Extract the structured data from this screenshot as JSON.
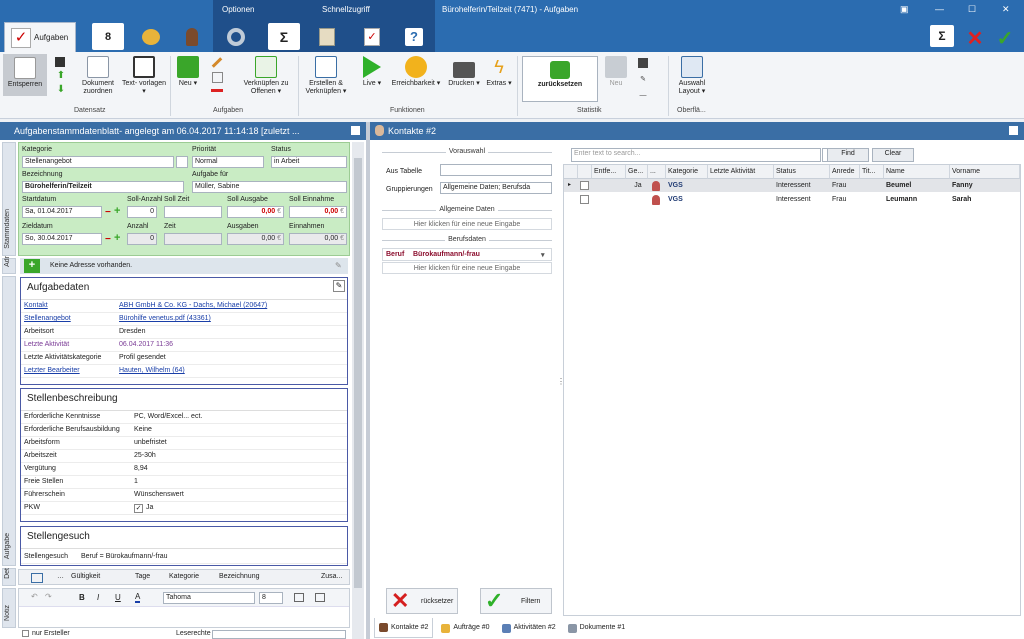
{
  "window": {
    "title": "Bürohelferin/Teilzeit (7471) - Aufgaben",
    "context_tabs": [
      "Optionen",
      "Schnellzugriff"
    ]
  },
  "ribbon": {
    "active_tab": "Aufgaben",
    "buttons": {
      "entsperren": "Entsperren",
      "dokument_zuordnen": "Dokument zuordnen",
      "textvorlagen": "Text- vorlagen ▾",
      "neu": "Neu ▾",
      "verknuepfen": "Verknüpfen zu Offenen ▾",
      "erstellen": "Erstellen & Verknüpfen ▾",
      "live": "Live ▾",
      "erreichbarkeit": "Erreichbarkeit ▾",
      "drucken": "Drucken ▾",
      "extras": "Extras ▾",
      "zuruecksetzen": "zurücksetzen",
      "neu2": "Neu",
      "auswahl_layout": "Auswahl Layout ▾"
    },
    "groups": {
      "datensatz": "Datensatz",
      "aufgaben": "Aufgaben",
      "funktionen": "Funktionen",
      "statistik": "Statistik",
      "oberflaeche": "Oberflä..."
    }
  },
  "left": {
    "header": "Aufgabenstammdatenblatt- angelegt am 06.04.2017 11:14:18 [zuletzt ...",
    "vtabs": [
      "Stammdaten",
      "Adr",
      "Aufgabe",
      "Det",
      "Notiz"
    ],
    "stamm": {
      "kategorie_label": "Kategorie",
      "kategorie": "Stellenangebot",
      "prioritaet_label": "Priorität",
      "prioritaet": "Normal",
      "status_label": "Status",
      "status": "in Arbeit",
      "bezeichnung_label": "Bezeichnung",
      "bezeichnung": "Bürohelferin/Teilzeit",
      "aufgabe_fuer_label": "Aufgabe für",
      "aufgabe_fuer": "Müller, Sabine",
      "startdatum_label": "Startdatum",
      "startdatum": "Sa, 01.04.2017",
      "soll_anzahl_label": "Soll-Anzahl",
      "soll_anzahl": "0",
      "soll_zeit_label": "Soll Zeit",
      "soll_ausgabe_label": "Soll Ausgabe",
      "soll_ausgabe": "0,00",
      "soll_einnahme_label": "Soll Einnahme",
      "soll_einnahme": "0,00",
      "zieldatum_label": "Zieldatum",
      "zieldatum": "So, 30.04.2017",
      "anzahl_label": "Anzahl",
      "anzahl": "0",
      "zeit_label": "Zeit",
      "ausgaben_label": "Ausgaben",
      "ausgaben": "0,00",
      "einnahmen_label": "Einnahmen",
      "einnahmen": "0,00",
      "currency": "€"
    },
    "adresse": "Keine Adresse vorhanden.",
    "aufgabendaten": {
      "title": "Aufgabedaten",
      "rows": [
        {
          "k": "Kontakt",
          "v": "ABH GmbH & Co. KG - Dachs, Michael (20647)"
        },
        {
          "k": "Stellenangebot",
          "v": "Bürohilfe venetus.pdf (43361)"
        },
        {
          "k": "Arbeitsort",
          "v": "Dresden"
        },
        {
          "k": "Letzte Aktivität",
          "v": "06.04.2017 11:36"
        },
        {
          "k": "Letzte Aktivitätskategorie",
          "v": "Profil gesendet"
        },
        {
          "k": "Letzter Bearbeiter",
          "v": "Hauten, Wilhelm (64)"
        }
      ]
    },
    "stellenbeschreibung": {
      "title": "Stellenbeschreibung",
      "rows": [
        {
          "k": "Erforderliche Kenntnisse",
          "v": "PC, Word/Excel... ect."
        },
        {
          "k": "Erforderliche Berufsausbildung",
          "v": "Keine"
        },
        {
          "k": "Arbeitsform",
          "v": "unbefristet"
        },
        {
          "k": "Arbeitszeit",
          "v": "25-30h"
        },
        {
          "k": "Vergütung",
          "v": "8,94"
        },
        {
          "k": "Freie Stellen",
          "v": "1"
        },
        {
          "k": "Führerschein",
          "v": "Wünschenswert"
        },
        {
          "k": "PKW",
          "v": "Ja"
        }
      ]
    },
    "stellengesuch": {
      "title": "Stellengesuch",
      "k": "Stellengesuch",
      "v": "Beruf = Bürokaufmann/-frau"
    },
    "det_cols": [
      "Gültigkeit",
      "Tage",
      "Kategorie",
      "Bezeichnung",
      "Zusa..."
    ],
    "notiz": {
      "font": "Tahoma",
      "size": "8"
    },
    "footer": {
      "nur_ersteller": "nur Ersteller",
      "leserechte": "Leserechte"
    }
  },
  "right": {
    "header": "Kontakte #2",
    "vorauswahl": "Vorauswahl",
    "aus_tabelle": "Aus Tabelle",
    "gruppierungen_label": "Gruppierungen",
    "gruppierungen": "Allgemeine Daten; Berufsda",
    "allgemeine_daten": "Allgemeine Daten",
    "hint": "Hier klicken für eine neue Eingabe",
    "berufsdaten": "Berufsdaten",
    "beruf_label": "Beruf",
    "beruf": "Bürokaufmann/-frau",
    "search_placeholder": "Enter text to search...",
    "find": "Find",
    "clear": "Clear",
    "columns": [
      "Entfe...",
      "Ge...",
      "...",
      "Kategorie",
      "Letzte Aktivität",
      "Status",
      "Anrede",
      "Tit...",
      "Name",
      "Vorname"
    ],
    "rows": [
      {
        "ge": "Ja",
        "kategorie": "VGS",
        "status": "Interessent",
        "anrede": "Frau",
        "name": "Beumel",
        "vorname": "Fanny"
      },
      {
        "ge": "",
        "kategorie": "VGS",
        "status": "Interessent",
        "anrede": "Frau",
        "name": "Leumann",
        "vorname": "Sarah"
      }
    ],
    "btn_reset": "rücksetzer",
    "btn_filter": "Filtern",
    "bottom_tabs": [
      "Kontakte #2",
      "Aufträge #0",
      "Aktivitäten #2",
      "Dokumente #1"
    ]
  },
  "colors": {
    "titlebar": "#2b6cb0",
    "context": "#1f4f8a",
    "panel_header": "#3a6ea5",
    "stamm_bg": "#c9ecc4",
    "box_border": "#4a59a6"
  }
}
